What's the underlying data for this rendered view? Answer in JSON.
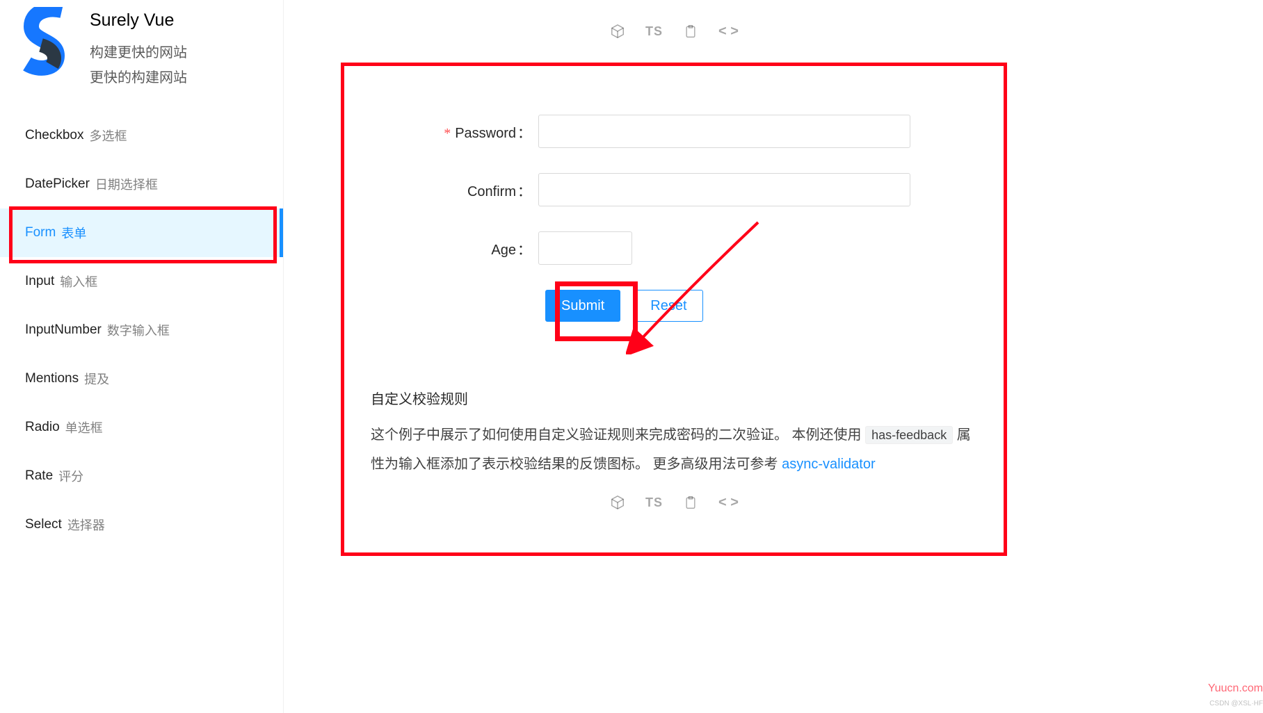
{
  "brand": {
    "title": "Surely Vue",
    "sub1": "构建更快的网站",
    "sub2": "更快的构建网站"
  },
  "nav": {
    "items": [
      {
        "en": "Checkbox",
        "cn": "多选框"
      },
      {
        "en": "DatePicker",
        "cn": "日期选择框"
      },
      {
        "en": "Form",
        "cn": "表单"
      },
      {
        "en": "Input",
        "cn": "输入框"
      },
      {
        "en": "InputNumber",
        "cn": "数字输入框"
      },
      {
        "en": "Mentions",
        "cn": "提及"
      },
      {
        "en": "Radio",
        "cn": "单选框"
      },
      {
        "en": "Rate",
        "cn": "评分"
      },
      {
        "en": "Select",
        "cn": "选择器"
      }
    ],
    "activeIndex": 2
  },
  "tools": {
    "ts": "TS",
    "code": "< >"
  },
  "form": {
    "password_label": "Password",
    "confirm_label": "Confirm",
    "age_label": "Age",
    "colon": "：",
    "submit_label": "Submit",
    "reset_label": "Reset"
  },
  "desc": {
    "title": "自定义校验规则",
    "p1_a": "这个例子中展示了如何使用自定义验证规则来完成密码的二次验证。 本例还使用 ",
    "code1": "has-feedback",
    "p1_b": " 属性为输入框添加了表示校验结果的反馈图标。 更多高级用法可参考 ",
    "link_text": "async-validator"
  },
  "watermark": "Yuucn.com",
  "credit": "CSDN @XSL·HF"
}
